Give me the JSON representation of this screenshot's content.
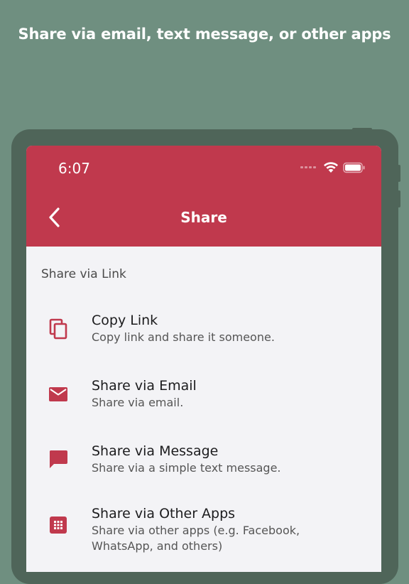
{
  "promo": {
    "caption": "Share via email, text message, or other apps"
  },
  "status_bar": {
    "time": "6:07",
    "icons": [
      "cellular-signal-icon",
      "wifi-icon",
      "battery-icon"
    ]
  },
  "nav": {
    "title": "Share",
    "back_icon": "chevron-left-icon"
  },
  "section": {
    "header": "Share via Link"
  },
  "items": [
    {
      "title": "Copy Link",
      "subtitle": "Copy link and share it someone.",
      "icon": "copy-icon"
    },
    {
      "title": "Share via Email",
      "subtitle": "Share via email.",
      "icon": "email-icon"
    },
    {
      "title": "Share via Message",
      "subtitle": "Share via a simple text message.",
      "icon": "message-icon"
    },
    {
      "title": "Share via Other Apps",
      "subtitle": "Share via other apps (e.g. Facebook, WhatsApp, and others)",
      "icon": "apps-grid-icon"
    }
  ],
  "colors": {
    "background": "#6f8f80",
    "device_frame": "#4f6559",
    "accent": "#c0394d",
    "screen_bg": "#f3f3f6"
  }
}
